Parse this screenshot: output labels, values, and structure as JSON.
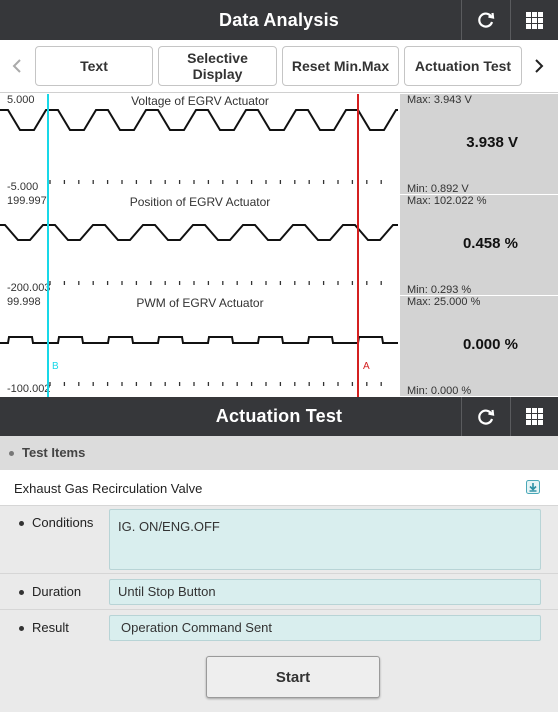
{
  "header": {
    "title": "Data Analysis"
  },
  "toolbar": {
    "buttons": [
      "Text",
      "Selective\nDisplay",
      "Reset Min.Max",
      "Actuation Test"
    ]
  },
  "graphs": [
    {
      "title": "Voltage of EGRV Actuator",
      "ymax": "5.000",
      "ymin": "-5.000",
      "max": "Max: 3.943 V",
      "min": "Min: 0.892 V",
      "current": "3.938 V",
      "signal": "trapezoid-a"
    },
    {
      "title": "Position of EGRV Actuator",
      "ymax": "199.997",
      "ymin": "-200.003",
      "max": "Max: 102.022 %",
      "min": "Min: 0.293 %",
      "current": "0.458 %",
      "signal": "trapezoid-b"
    },
    {
      "title": "PWM of EGRV Actuator",
      "ymax": "99.998",
      "ymin": "-100.002",
      "max": "Max: 25.000 %",
      "min": "Min: 0.000 %",
      "current": "0.000 %",
      "signal": "pulse"
    }
  ],
  "cursors": {
    "b_label": "B",
    "a_label": "A",
    "b_color": "#18d8e8",
    "a_color": "#d42020"
  },
  "actuation": {
    "title": "Actuation Test",
    "section_label": "Test Items",
    "item_name": "Exhaust Gas Recirculation Valve",
    "conditions_label": "Conditions",
    "conditions_value": "IG. ON/ENG.OFF",
    "duration_label": "Duration",
    "duration_value": "Until Stop Button",
    "result_label": "Result",
    "result_value": "Operation Command Sent",
    "start_label": "Start"
  },
  "icons": {
    "refresh": "refresh-icon",
    "grid": "grid-menu-icon",
    "left": "chevron-left-icon",
    "right": "chevron-right-icon",
    "download": "download-icon"
  },
  "colors": {
    "header_bg": "#36373a",
    "side_bg": "#d3d3d3",
    "field_bg": "#d9eeee"
  }
}
